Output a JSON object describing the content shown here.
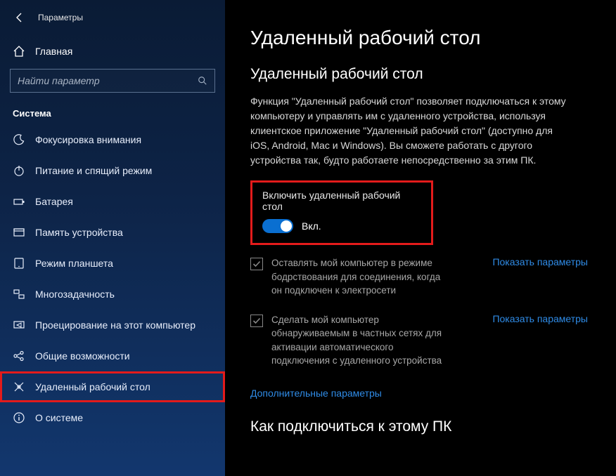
{
  "window": {
    "title": "Параметры"
  },
  "home": {
    "label": "Главная"
  },
  "search": {
    "placeholder": "Найти параметр"
  },
  "group": {
    "label": "Система"
  },
  "nav": {
    "items": [
      {
        "label": "Фокусировка внимания"
      },
      {
        "label": "Питание и спящий режим"
      },
      {
        "label": "Батарея"
      },
      {
        "label": "Память устройства"
      },
      {
        "label": "Режим планшета"
      },
      {
        "label": "Многозадачность"
      },
      {
        "label": "Проецирование на этот компьютер"
      },
      {
        "label": "Общие возможности"
      },
      {
        "label": "Удаленный рабочий стол"
      },
      {
        "label": "О системе"
      }
    ]
  },
  "main": {
    "heading": "Удаленный рабочий стол",
    "subheading": "Удаленный рабочий стол",
    "description": "Функция \"Удаленный рабочий стол\" позволяет подключаться к этому компьютеру и управлять им с удаленного устройства, используя клиентское приложение \"Удаленный рабочий стол\" (доступно для iOS, Android, Mac и Windows). Вы сможете работать с другого устройства так, будто работаете непосредственно за этим ПК.",
    "toggle": {
      "label": "Включить удаленный рабочий стол",
      "state": "Вкл."
    },
    "options": [
      {
        "text": "Оставлять мой компьютер в режиме бодрствования для соединения, когда он подключен к электросети",
        "link": "Показать параметры"
      },
      {
        "text": "Сделать мой компьютер обнаруживаемым в частных сетях для активации автоматического подключения с удаленного устройства",
        "link": "Показать параметры"
      }
    ],
    "advanced_link": "Дополнительные параметры",
    "connect_heading": "Как подключиться к этому ПК"
  }
}
